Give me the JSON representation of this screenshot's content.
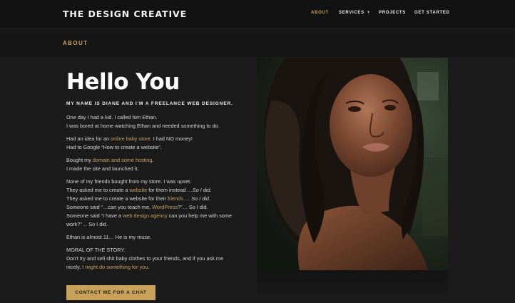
{
  "header": {
    "logo": "THE DESIGN CREATIVE",
    "nav": [
      {
        "label": "ABOUT",
        "active": true,
        "has_dropdown": false
      },
      {
        "label": "SERVICES",
        "active": false,
        "has_dropdown": true
      },
      {
        "label": "PROJECTS",
        "active": false,
        "has_dropdown": false
      },
      {
        "label": "GET STARTED",
        "active": false,
        "has_dropdown": false
      }
    ],
    "dropdown_glyph": "+"
  },
  "section_label": "ABOUT",
  "hero": {
    "title": "Hello You",
    "subtitle": "MY NAME IS DIANE AND I'M A FREELANCE WEB DESIGNER."
  },
  "story": {
    "p1_l1": "One day I had a kid. I called him Ethan.",
    "p1_l2": "I was bored at home watching Ethan and needed something to do.",
    "p2_a": "Had an idea for an ",
    "p2_link": "online baby store",
    "p2_b": ". I had NO money!",
    "p2_l2": "Had to Google “How to create a website”.",
    "p3_a": "Bought my ",
    "p3_link": "domain and some hosting",
    "p3_b": ".",
    "p3_l2": "I made the site and launched it.",
    "p4_l1": "None of my friends bought from my store. I was upset.",
    "p4_l2_a": "They asked me to create a ",
    "p4_l2_link": "website",
    "p4_l2_b": " for them instead …",
    "p4_l2_em": "So I did.",
    "p4_l3_a": "They asked me to create a website for their ",
    "p4_l3_link": "friends",
    "p4_l3_b": " … ",
    "p4_l3_em": "So I did.",
    "p4_l4_a": "Someone said “…can you teach me, ",
    "p4_l4_link": "WordPress",
    "p4_l4_b": "?”… So I did.",
    "p4_l5_a": "Someone said “I have a ",
    "p4_l5_link": "web design agency",
    "p4_l5_b": " can you help me with some work?”… So I did.",
    "p5": "Ethan is almost 11… He is my muse.",
    "moral_heading": "MORAL OF THE STORY:",
    "moral_l1": "Don't try and sell shit baby clothes to your friends, and if you ask me",
    "moral_l2_a": "nicely, ",
    "moral_l2_link": "I might do something for you",
    "moral_l2_b": "."
  },
  "cta_label": "CONTACT ME FOR A CHAT",
  "colors": {
    "accent": "#c9a25a",
    "background": "#161616",
    "text": "#d6d6d6"
  }
}
